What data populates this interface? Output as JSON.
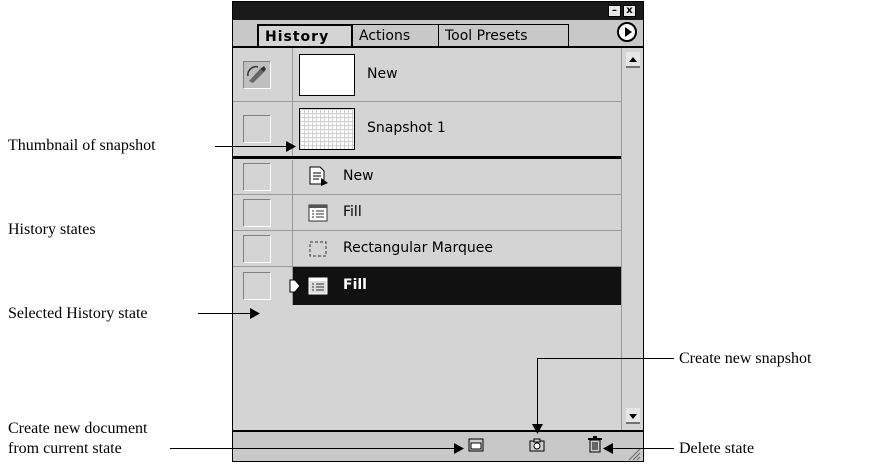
{
  "panel": {
    "window_controls": {
      "minimize": "–",
      "close": "x"
    },
    "tabs": [
      {
        "label": "History",
        "active": true
      },
      {
        "label": "Actions",
        "active": false
      },
      {
        "label": "Tool Presets",
        "active": false
      }
    ],
    "snapshots": [
      {
        "label": "New",
        "thumbnail": "blank-white"
      },
      {
        "label": "Snapshot 1",
        "thumbnail": "grid"
      }
    ],
    "states": [
      {
        "label": "New",
        "icon": "new-document-icon",
        "selected": false
      },
      {
        "label": "Fill",
        "icon": "fill-icon",
        "selected": false
      },
      {
        "label": "Rectangular Marquee",
        "icon": "marquee-icon",
        "selected": false
      },
      {
        "label": "Fill",
        "icon": "fill-icon",
        "selected": true
      }
    ],
    "bottom_buttons": [
      "new-document-from-state-icon",
      "camera-snapshot-icon",
      "trash-icon"
    ]
  },
  "callouts": {
    "thumbnail": "Thumbnail of snapshot",
    "history_states": "History states",
    "selected_state": "Selected History state",
    "new_doc_line1": "Create new document",
    "new_doc_line2": "from current state",
    "new_snapshot": "Create new snapshot",
    "delete_state": "Delete state"
  },
  "colors": {
    "selected_row": "#111111",
    "panel_bg": "#d4d4d4",
    "titlebar": "#1a1a1a"
  }
}
